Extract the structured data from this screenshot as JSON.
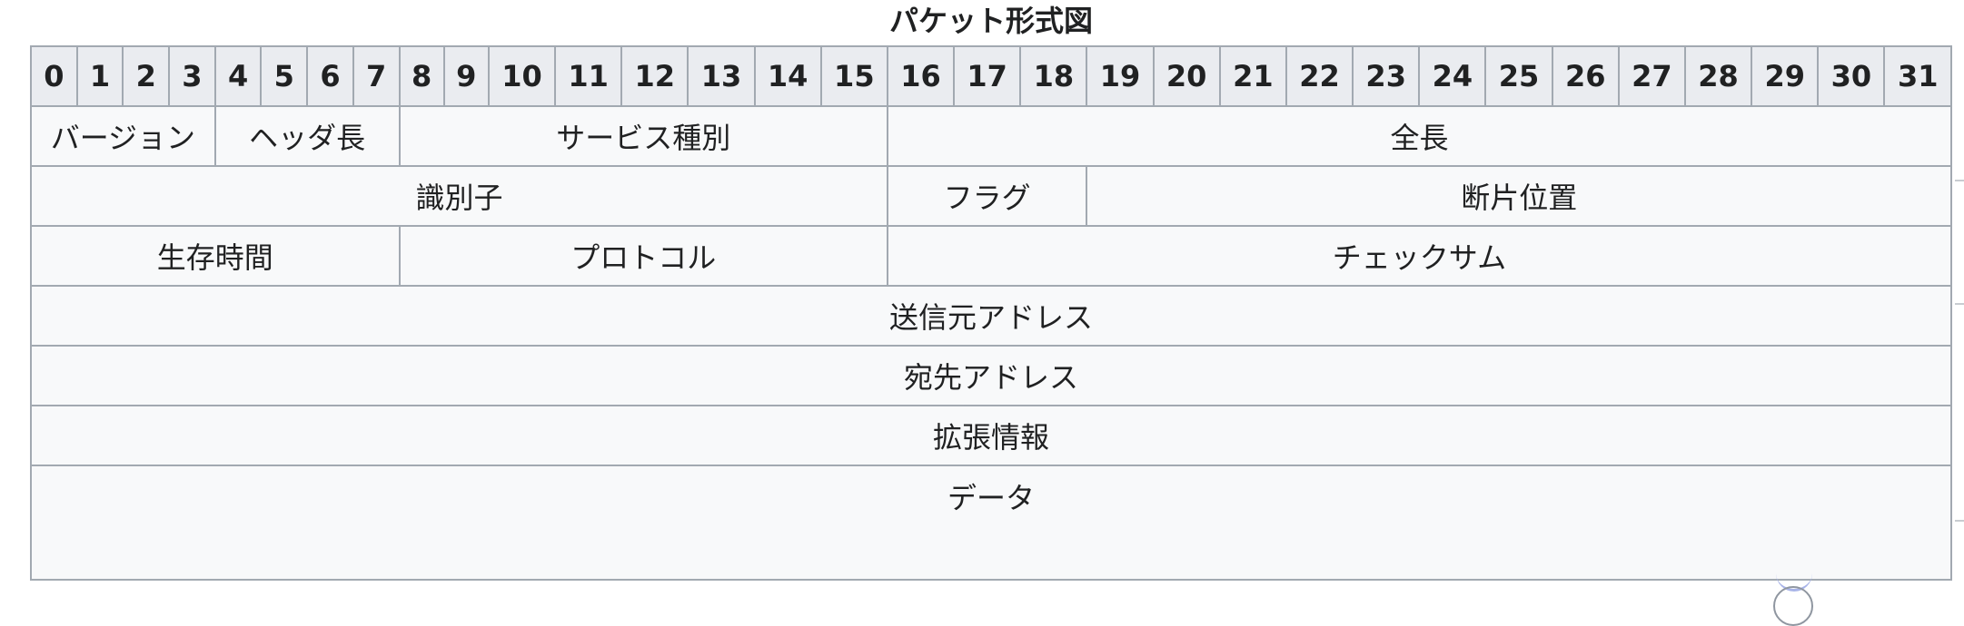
{
  "caption": "パケット形式図",
  "bit_labels": [
    "0",
    "1",
    "2",
    "3",
    "4",
    "5",
    "6",
    "7",
    "8",
    "9",
    "10",
    "11",
    "12",
    "13",
    "14",
    "15",
    "16",
    "17",
    "18",
    "19",
    "20",
    "21",
    "22",
    "23",
    "24",
    "25",
    "26",
    "27",
    "28",
    "29",
    "30",
    "31"
  ],
  "fields": {
    "version": "バージョン",
    "header_length": "ヘッダ長",
    "service_type": "サービス種別",
    "total_length": "全長",
    "identifier": "識別子",
    "flags": "フラグ",
    "fragment_offset": "断片位置",
    "ttl": "生存時間",
    "protocol": "プロトコル",
    "checksum": "チェックサム",
    "source_address": "送信元アドレス",
    "destination_address": "宛先アドレス",
    "options": "拡張情報",
    "data": "データ"
  },
  "colors": {
    "border": "#a2a9b1",
    "header_background": "#eaecf0",
    "cell_background": "#f8f9fa",
    "text": "#202122"
  }
}
